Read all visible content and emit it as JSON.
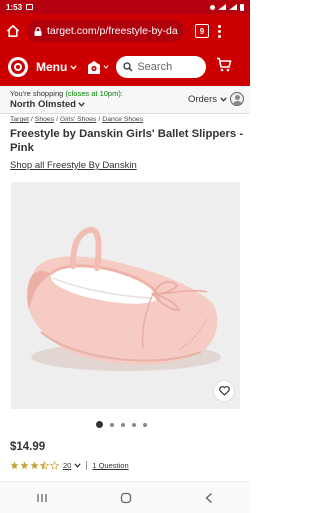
{
  "status": {
    "time": "1:53"
  },
  "browser": {
    "url": "target.com/p/freestyle-by-da",
    "tab_count": "9"
  },
  "header": {
    "menu_label": "Menu",
    "search_placeholder": "Search"
  },
  "store": {
    "label": "You're shopping",
    "hours": "(closes at 10pm):",
    "name": "North Olmsted",
    "orders_label": "Orders"
  },
  "breadcrumb": [
    "Target",
    "Shoes",
    "Girls' Shoes",
    "Dance Shoes"
  ],
  "product": {
    "title": "Freestyle by Danskin Girls' Ballet Slippers - Pink",
    "shop_all": "Shop all Freestyle By Danskin",
    "price": "$14.99",
    "rating_value": 3.5,
    "rating_count": "20",
    "questions": "1 Question",
    "image_count": 5,
    "active_image": 1
  },
  "colors": {
    "brand_red": "#cc0000",
    "status_red": "#b5000f",
    "star_gold": "#c4a33a",
    "shoe_pink": "#f4c7bf"
  },
  "icons": [
    "home-icon",
    "lock-icon",
    "tab-switcher-icon",
    "more-vert-icon",
    "target-logo-icon",
    "chevron-down-icon",
    "store-icon",
    "search-icon",
    "cart-icon",
    "account-icon",
    "heart-icon",
    "star-icon",
    "recents-icon",
    "home-nav-icon",
    "back-icon"
  ]
}
